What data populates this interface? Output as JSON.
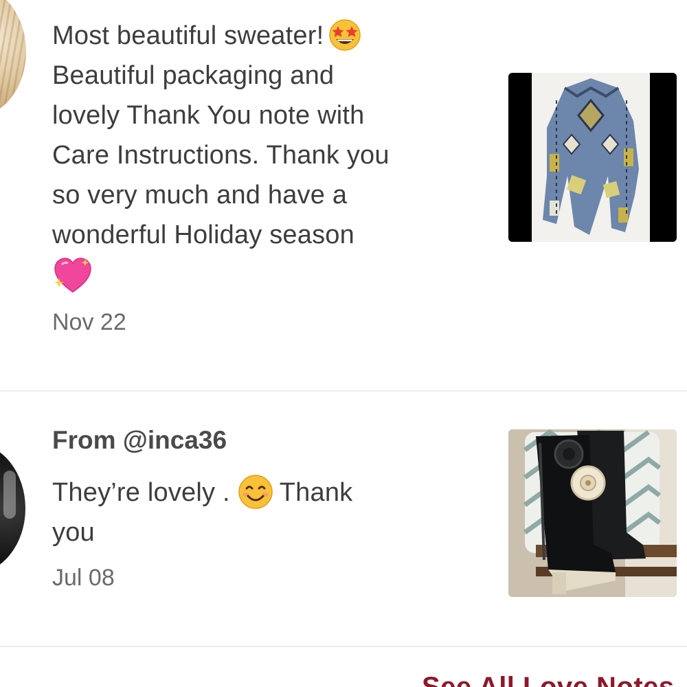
{
  "notes": [
    {
      "lines": [
        "Most beautiful sweater!",
        "Beautiful packaging and",
        "lovely Thank You note with",
        "Care Instructions. Thank you",
        "so very much and have a",
        "wonderful Holiday season"
      ],
      "emojis": [
        "star-struck-emoji",
        "sparkling-heart-emoji"
      ],
      "date": "Nov 22",
      "image": "blue patterned draped sweater"
    },
    {
      "from": "From @inca36",
      "text_before_emoji": "They’re lovely .",
      "text_after_emoji_line1": "Thank",
      "text_line2": "you",
      "emojis": [
        "smiling-face-emoji"
      ],
      "date": "Jul 08",
      "image": "black rain boots with camellia flowers"
    }
  ],
  "footer": {
    "see_all_label": "See All Love Notes"
  },
  "colors": {
    "text": "#3d3d3d",
    "date": "#6a6a6a",
    "divider": "#ececec",
    "link": "#8b1a2b"
  }
}
